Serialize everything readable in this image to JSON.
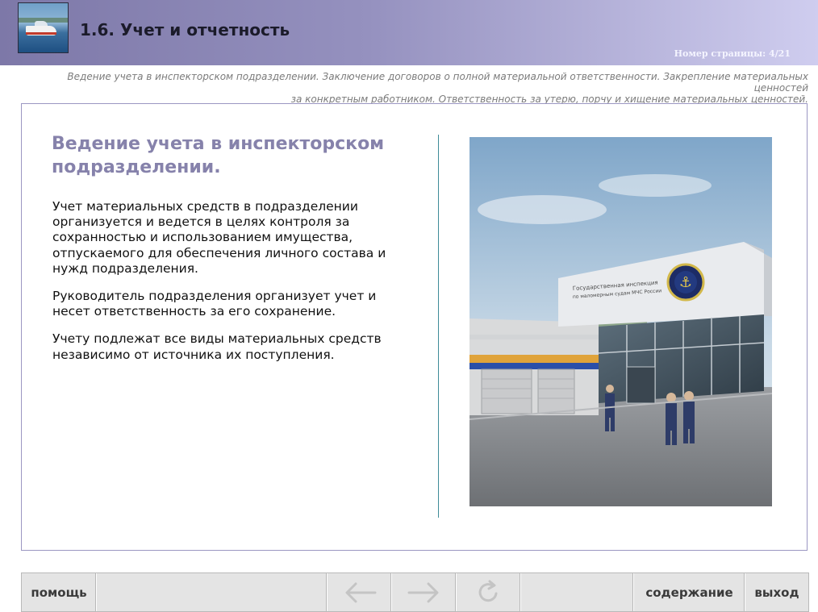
{
  "header": {
    "title": "1.6. Учет и отчетность",
    "page_number": "Номер страницы: 4/21",
    "logo_icon": "boat-logo-icon"
  },
  "subtitle": {
    "line1": "Ведение учета в инспекторском подразделении. Заключение договоров о полной материальной ответственности. Закрепление материальных ценностей",
    "line2": "за конкретным работником. Ответственность за утерю, порчу и хищение материальных ценностей."
  },
  "content": {
    "heading_line1": "Ведение учета в инспекторском",
    "heading_line2": "подразделении.",
    "paragraphs": [
      "Учет материальных средств в подразделении организуется и ведется в целях контроля за сохранностью и использованием имущества, отпускаемого для обеспечения личного состава и нужд подразделения.",
      "Руководитель подразделения организует учет и несет ответственность за его сохранение.",
      "Учету подлежат все виды материальных средств независимо от источника их поступления."
    ],
    "building_sign_line1": "Государственная инспекция",
    "building_sign_line2": "по маломерным судам МЧС России"
  },
  "footer": {
    "help": "помощь",
    "contents": "содержание",
    "exit": "выход",
    "back_icon": "arrow-left-icon",
    "forward_icon": "arrow-right-icon",
    "reload_icon": "reload-icon"
  },
  "colors": {
    "header_start": "#7d78a8",
    "header_end": "#cfcdef",
    "heading": "#8682ab",
    "divider": "#3f8c98"
  }
}
